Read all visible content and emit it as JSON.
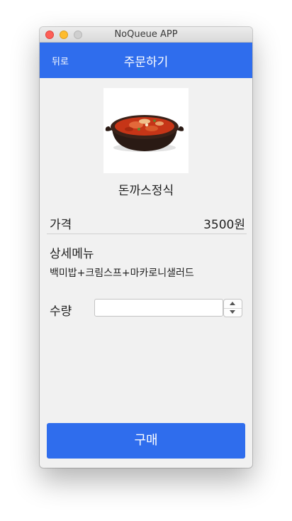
{
  "window": {
    "title": "NoQueue APP"
  },
  "navbar": {
    "back_label": "뒤로",
    "title": "주문하기"
  },
  "item": {
    "name": "돈까스정식",
    "price_label": "가격",
    "price_value": "3500원",
    "detail_label": "상세메뉴",
    "detail_text": "백미밥+크림스프+마카로니샐러드"
  },
  "quantity": {
    "label": "수량",
    "value": ""
  },
  "purchase": {
    "label": "구매"
  },
  "colors": {
    "accent": "#2f6ded",
    "background": "#f1f1f1"
  }
}
